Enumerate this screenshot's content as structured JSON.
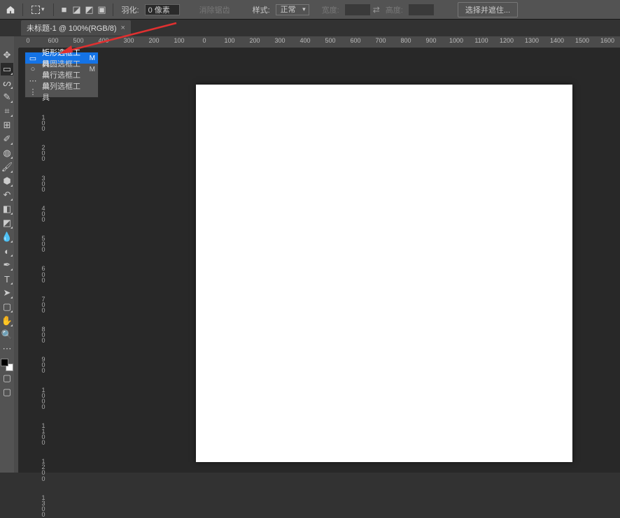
{
  "options": {
    "feather_label": "羽化:",
    "feather_value": "0 像素",
    "antialias_label": "消除锯齿",
    "style_label": "样式:",
    "style_value": "正常",
    "width_label": "宽度:",
    "height_label": "高度:",
    "select_mask_btn": "选择并遮住..."
  },
  "tab": {
    "title": "未标题-1 @ 100%(RGB/8)",
    "close": "×"
  },
  "ruler_h": [
    "0",
    "600",
    "500",
    "400",
    "300",
    "200",
    "100",
    "0",
    "100",
    "200",
    "300",
    "400",
    "500",
    "600",
    "700",
    "800",
    "900",
    "1000",
    "1100",
    "1200",
    "1300",
    "1400",
    "1500",
    "1600"
  ],
  "ruler_v": [
    "100",
    "200",
    "300",
    "400",
    "500",
    "600",
    "700",
    "800",
    "900",
    "1000",
    "1100",
    "1200",
    "1300"
  ],
  "flyout": {
    "items": [
      {
        "icon": "▭",
        "label": "矩形选框工具",
        "key": "M",
        "selected": true
      },
      {
        "icon": "○",
        "label": "椭圆选框工具",
        "key": "M",
        "selected": false
      },
      {
        "icon": "⋯",
        "label": "单行选框工具",
        "key": "",
        "selected": false
      },
      {
        "icon": "⋮",
        "label": "单列选框工具",
        "key": "",
        "selected": false
      }
    ]
  },
  "tools": [
    {
      "name": "move-tool",
      "glyph": "✥"
    },
    {
      "name": "marquee-tool",
      "glyph": "▭",
      "active": true,
      "tri": true
    },
    {
      "name": "lasso-tool",
      "glyph": "ᔕ",
      "tri": true
    },
    {
      "name": "quick-select-tool",
      "glyph": "✎",
      "tri": true
    },
    {
      "name": "crop-tool",
      "glyph": "⌗",
      "tri": true
    },
    {
      "name": "frame-tool",
      "glyph": "⊞"
    },
    {
      "name": "eyedropper-tool",
      "glyph": "✐",
      "tri": true
    },
    {
      "name": "healing-tool",
      "glyph": "◍",
      "tri": true
    },
    {
      "name": "brush-tool",
      "glyph": "🖌",
      "tri": true
    },
    {
      "name": "stamp-tool",
      "glyph": "⬢",
      "tri": true
    },
    {
      "name": "history-brush-tool",
      "glyph": "↶",
      "tri": true
    },
    {
      "name": "eraser-tool",
      "glyph": "◧",
      "tri": true
    },
    {
      "name": "gradient-tool",
      "glyph": "◩",
      "tri": true
    },
    {
      "name": "blur-tool",
      "glyph": "💧",
      "tri": true
    },
    {
      "name": "dodge-tool",
      "glyph": "◐",
      "tri": true
    },
    {
      "name": "pen-tool",
      "glyph": "✒",
      "tri": true
    },
    {
      "name": "type-tool",
      "glyph": "T",
      "tri": true
    },
    {
      "name": "path-select-tool",
      "glyph": "➤",
      "tri": true
    },
    {
      "name": "shape-tool",
      "glyph": "▢",
      "tri": true
    },
    {
      "name": "hand-tool",
      "glyph": "✋",
      "tri": true
    },
    {
      "name": "zoom-tool",
      "glyph": "🔍"
    },
    {
      "name": "more-tool",
      "glyph": "⋯"
    }
  ]
}
